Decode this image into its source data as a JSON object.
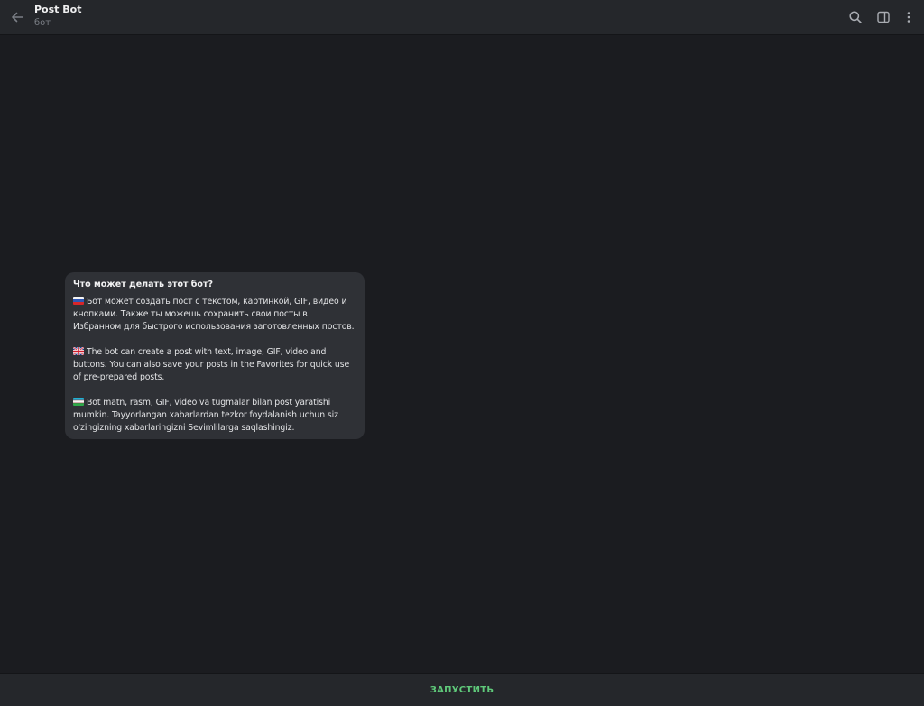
{
  "header": {
    "title": "Post Bot",
    "subtitle": "бот",
    "icons": {
      "back": "back-arrow-icon",
      "search": "search-icon",
      "sidebar": "sidebar-toggle-icon",
      "menu": "more-vertical-icon"
    }
  },
  "bot_info": {
    "title": "Что может делать этот бот?",
    "paragraphs": [
      {
        "flag": "russia-flag-icon",
        "text": "Бот может создать пост с текстом, картинкой,  GIF, видео и кнопками. Также ты  можешь сохранить свои посты в Избранном для быстрого использования заготовленных постов."
      },
      {
        "flag": "uk-flag-icon",
        "text": "The bot can create a post with text, image, GIF, video and buttons. You can also save your posts in the Favorites for quick use of pre-prepared posts."
      },
      {
        "flag": "uzbekistan-flag-icon",
        "text": "Bot matn, rasm, GIF, video va tugmalar bilan post yaratishi mumkin. Tayyorlangan xabarlardan tezkor foydalanish uchun siz o'zingizning xabarlaringizni Sevimlilarga saqlashingiz."
      }
    ]
  },
  "bottom_bar": {
    "start_label": "ЗАПУСТИТЬ"
  },
  "colors": {
    "background": "#1b1c20",
    "header": "#25272b",
    "card": "#2f3136",
    "accent": "#5fc97a",
    "subtitle": "#7b7f86"
  }
}
